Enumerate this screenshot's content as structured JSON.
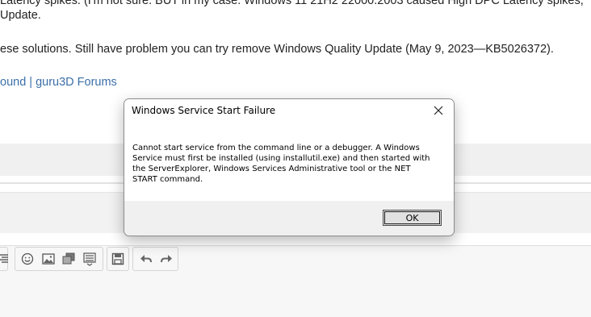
{
  "background": {
    "line1": "Latency spikes. (I'm not sure. BUT in my case: Windows 11 21H2 22000.2003 caused High DPC Latency spikes,",
    "line2": "Update.",
    "line3": "ese solutions. Still have problem you can try remove Windows Quality Update (May 9, 2023—KB5026372).",
    "link": "ound | guru3D Forums",
    "link_color": "#3b6fa8"
  },
  "toolbar": {
    "icons": [
      "align-icon",
      "emoji-icon",
      "image-icon",
      "media-icon",
      "list-icon",
      "save-icon",
      "undo-icon",
      "redo-icon"
    ]
  },
  "dialog": {
    "title": "Windows Service Start Failure",
    "message": "Cannot start service from the command line or a debugger.  A Windows Service must first be installed (using installutil.exe) and then started with the ServerExplorer, Windows Services Administrative tool or the NET START command.",
    "ok_label": "OK"
  }
}
